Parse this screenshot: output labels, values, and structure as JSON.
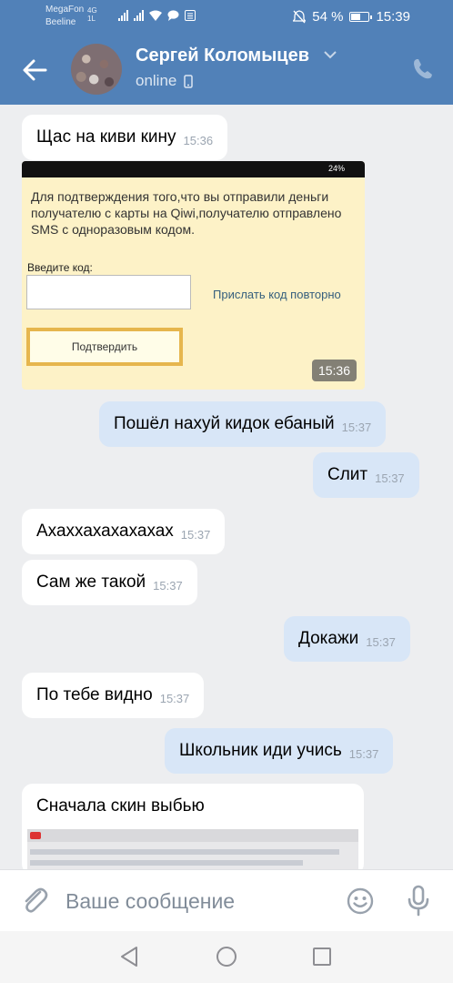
{
  "statusbar": {
    "carrier_top": "MegaFon",
    "carrier_bottom": "Beeline",
    "net_top": "4G",
    "net_bottom": "1L",
    "battery": "54 %",
    "time": "15:39"
  },
  "header": {
    "name": "Сергей Коломыцев",
    "status": "online"
  },
  "messages": [
    {
      "text": "Щас на киви кину",
      "time": "15:36"
    },
    {
      "text": "Пошёл нахуй кидок ебаный",
      "time": "15:37"
    },
    {
      "text": "Слит",
      "time": "15:37"
    },
    {
      "text": "Ахаххахахахахах",
      "time": "15:37"
    },
    {
      "text": "Сам же такой",
      "time": "15:37"
    },
    {
      "text": "Докажи",
      "time": "15:37"
    },
    {
      "text": "По тебе видно",
      "time": "15:37"
    },
    {
      "text": "Школьник иди учись",
      "time": "15:37"
    },
    {
      "text": "Сначала скин выбью"
    }
  ],
  "screenshot": {
    "status_pct": "24%",
    "body": "Для подтверждения того,что вы отправили деньги получателю с карты на Qiwi,получателю отправлено SMS с одноразовым кодом.",
    "code_label": "Введите код:",
    "resend": "Прислать код повторно",
    "confirm": "Подтвердить",
    "time": "15:36"
  },
  "composer": {
    "placeholder": "Ваше сообщение"
  },
  "colors": {
    "header": "#5181b8",
    "incoming": "#ffffff",
    "outgoing": "#d8e6f7"
  }
}
